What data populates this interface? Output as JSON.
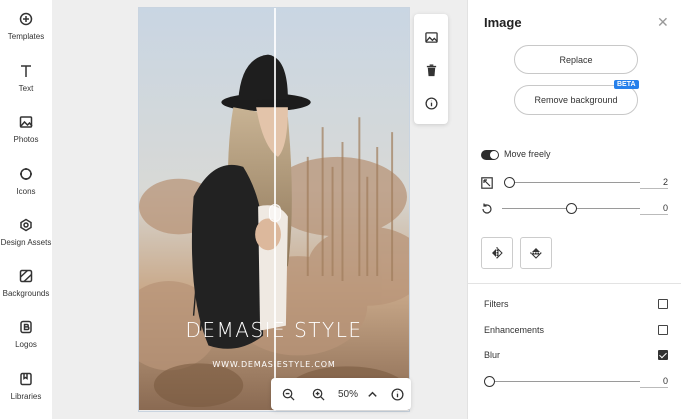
{
  "sidebar": {
    "items": [
      {
        "label": "Templates",
        "icon": "templates-icon"
      },
      {
        "label": "Text",
        "icon": "text-icon"
      },
      {
        "label": "Photos",
        "icon": "photos-icon"
      },
      {
        "label": "Icons",
        "icon": "icons-icon"
      },
      {
        "label": "Design Assets",
        "icon": "design-assets-icon"
      },
      {
        "label": "Backgrounds",
        "icon": "backgrounds-icon"
      },
      {
        "label": "Logos",
        "icon": "logos-icon"
      },
      {
        "label": "Libraries",
        "icon": "libraries-icon"
      }
    ]
  },
  "canvas": {
    "brand_title": "DEMASIE STYLE",
    "brand_url": "WWW.DEMASIESTYLE.COM"
  },
  "zoom": {
    "value": "50%"
  },
  "panel": {
    "title": "Image",
    "replace_label": "Replace",
    "remove_bg_label": "Remove background",
    "beta_badge": "BETA",
    "move_freely_label": "Move freely",
    "move_freely_on": true,
    "scale_value": "2",
    "scale_fraction": 0.02,
    "rotate_value": "0",
    "rotate_fraction": 0.5,
    "filters_label": "Filters",
    "filters_checked": false,
    "enhancements_label": "Enhancements",
    "enhancements_checked": false,
    "blur_label": "Blur",
    "blur_checked": true,
    "blur_value": "0",
    "blur_fraction": 0
  },
  "colors": {
    "accent": "#2680eb",
    "panel_bg": "#ffffff",
    "canvas_bg": "#eeeeee"
  }
}
